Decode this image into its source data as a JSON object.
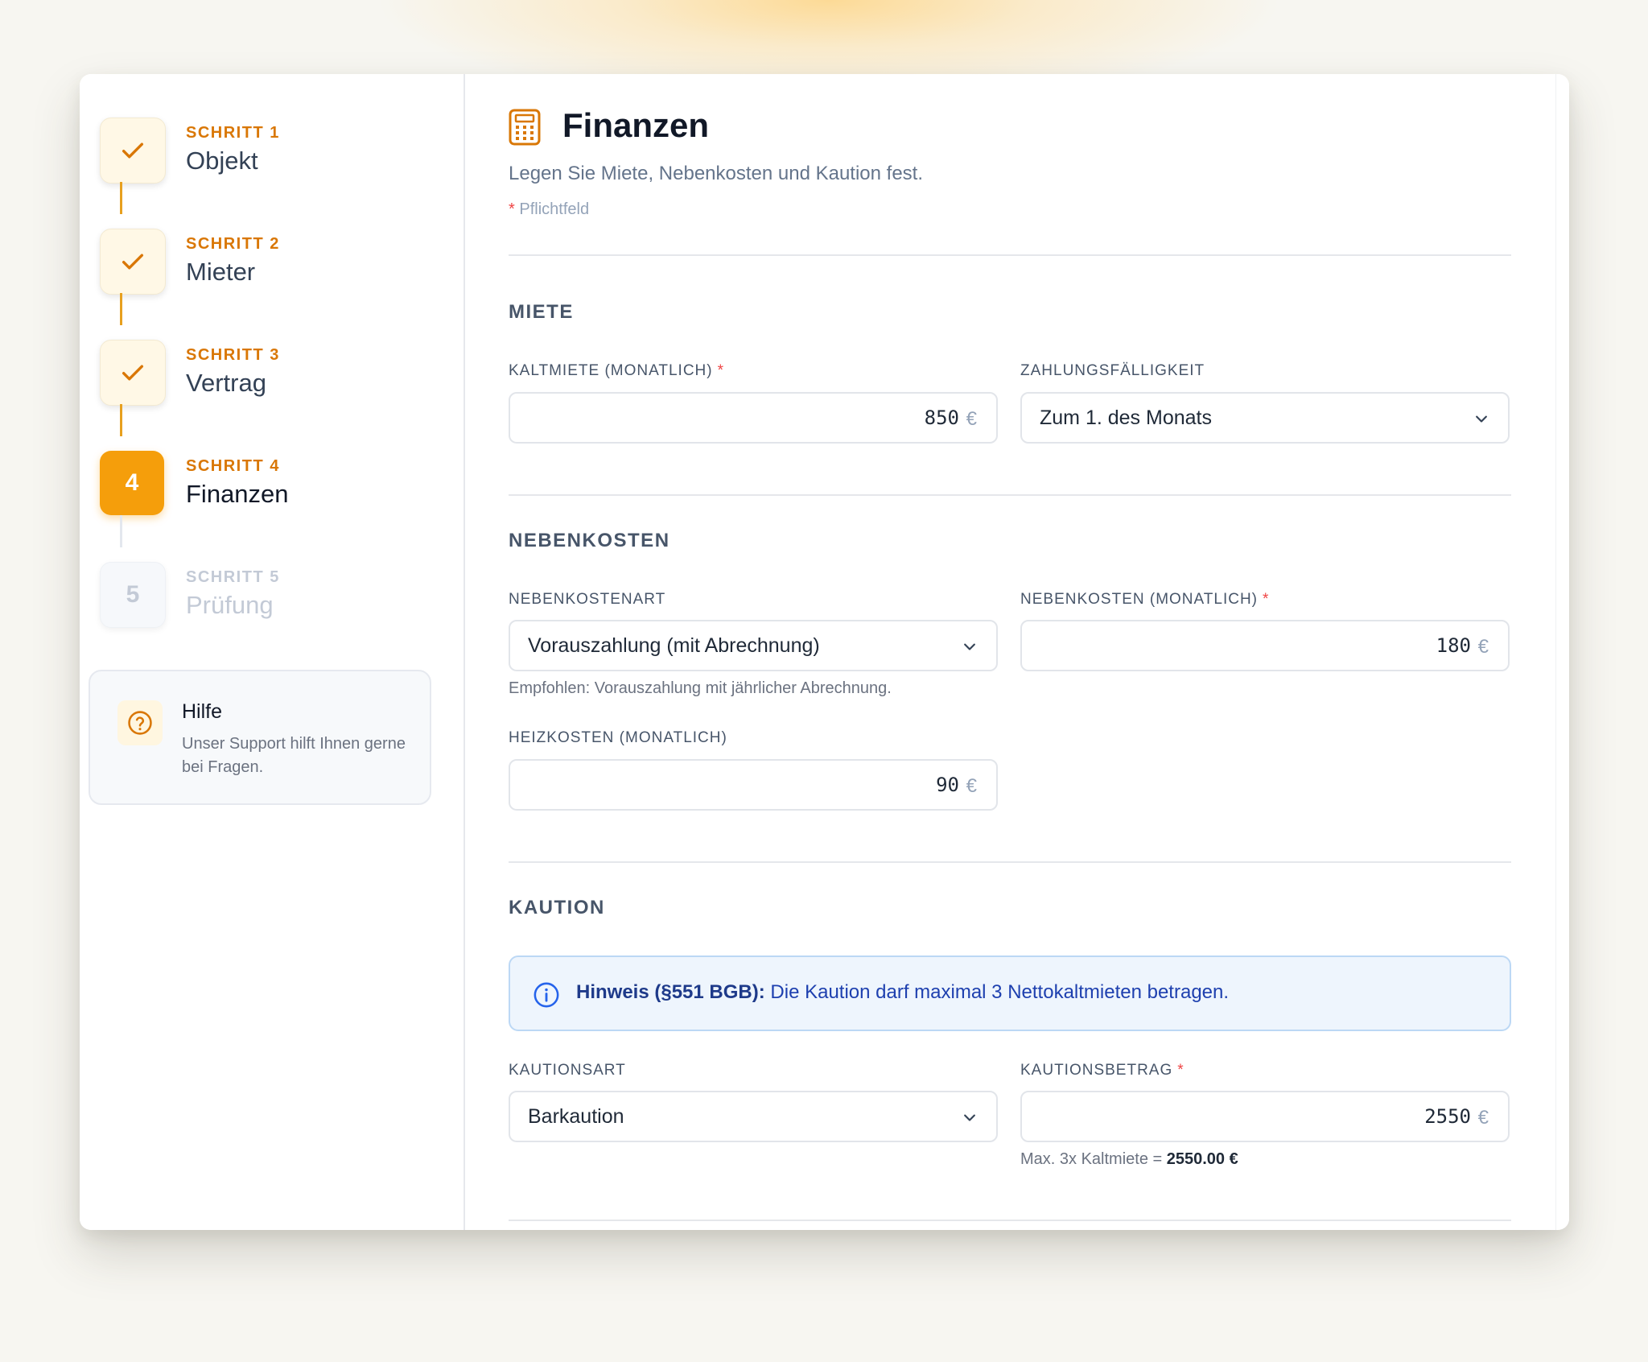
{
  "steps": [
    {
      "kicker": "SCHRITT 1",
      "title": "Objekt",
      "state": "done"
    },
    {
      "kicker": "SCHRITT 2",
      "title": "Mieter",
      "state": "done"
    },
    {
      "kicker": "SCHRITT 3",
      "title": "Vertrag",
      "state": "done"
    },
    {
      "kicker": "SCHRITT 4",
      "title": "Finanzen",
      "state": "active",
      "number": "4"
    },
    {
      "kicker": "SCHRITT 5",
      "title": "Prüfung",
      "state": "pending",
      "number": "5"
    }
  ],
  "help": {
    "title": "Hilfe",
    "text": "Unser Support hilft Ihnen gerne bei Fragen.",
    "icon": "help-circle-icon"
  },
  "page": {
    "title": "Finanzen",
    "icon": "calculator-icon",
    "subtitle": "Legen Sie Miete, Nebenkosten und Kaution fest.",
    "required_star": "*",
    "required_note": "Pflichtfeld"
  },
  "sections": {
    "miete": {
      "title": "MIETE",
      "kaltmiete_label": "KALTMIETE (MONATLICH)",
      "kaltmiete_value": "850",
      "faelligkeit_label": "ZAHLUNGSFÄLLIGKEIT",
      "faelligkeit_value": "Zum 1. des Monats"
    },
    "nebenkosten": {
      "title": "NEBENKOSTEN",
      "art_label": "NEBENKOSTENART",
      "art_value": "Vorauszahlung (mit Abrechnung)",
      "art_hint": "Empfohlen: Vorauszahlung mit jährlicher Abrechnung.",
      "monatlich_label": "NEBENKOSTEN (MONATLICH)",
      "monatlich_value": "180",
      "heiz_label": "HEIZKOSTEN (MONATLICH)",
      "heiz_value": "90"
    },
    "kaution": {
      "title": "KAUTION",
      "notice_bold": "Hinweis (§551 BGB):",
      "notice_text": " Die Kaution darf maximal 3 Nettokaltmieten betragen.",
      "art_label": "KAUTIONSART",
      "art_value": "Barkaution",
      "betrag_label": "KAUTIONSBETRAG",
      "betrag_value": "2550",
      "betrag_hint_prefix": "Max. 3x Kaltmiete = ",
      "betrag_hint_value": "2550.00 €"
    }
  },
  "currency": "€",
  "colors": {
    "accent": "#f59e0b",
    "accent_text": "#d97706",
    "required": "#ef4444",
    "info": "#1e40af"
  }
}
